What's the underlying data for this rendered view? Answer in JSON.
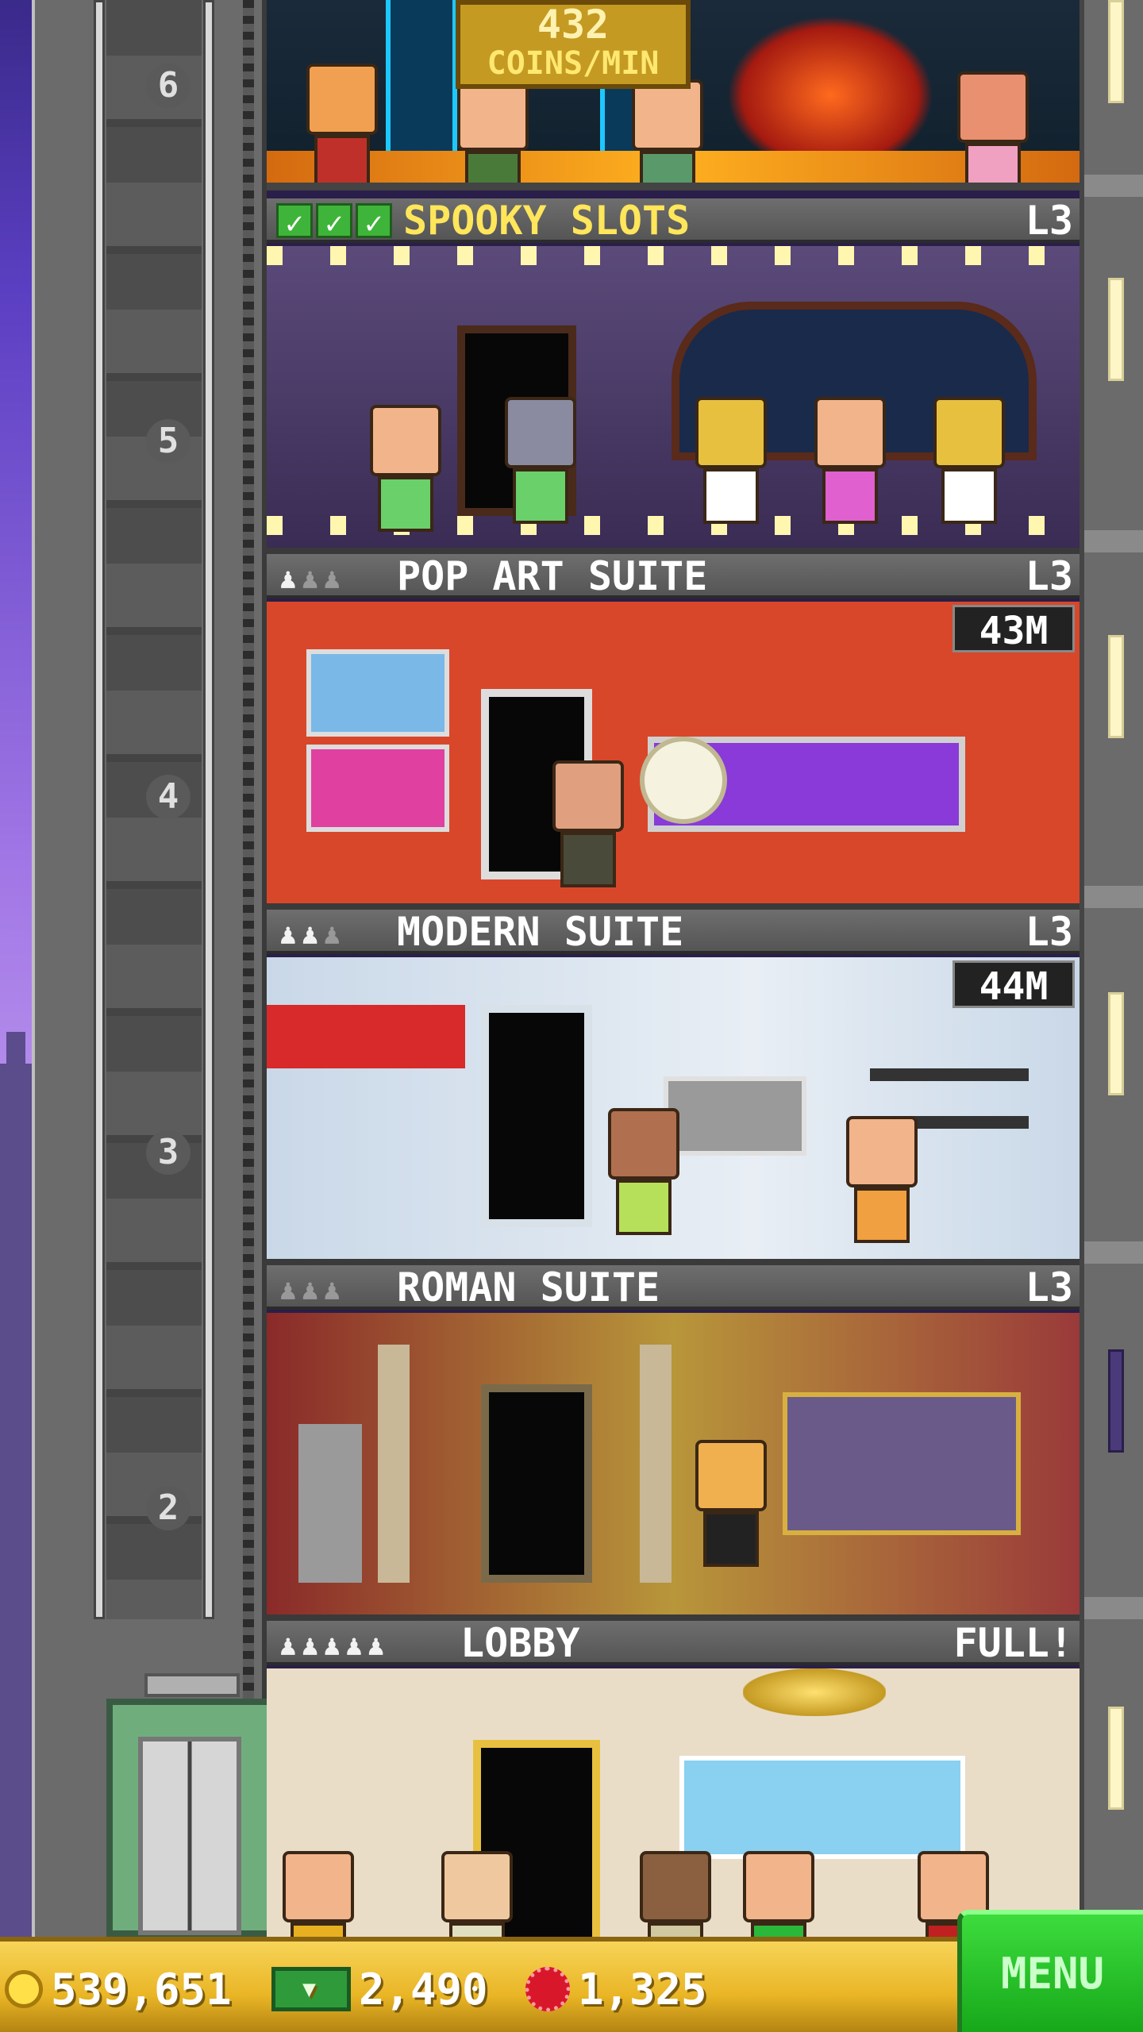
{
  "elevator": {
    "floor_numbers": [
      "6",
      "5",
      "4",
      "3",
      "2"
    ]
  },
  "top_floor": {
    "coins_rate_value": "432",
    "coins_rate_unit": "COINS/MIN"
  },
  "floors": [
    {
      "name": "SPOOKY SLOTS",
      "level": "L3",
      "checks": 3
    },
    {
      "name": "POP ART SUITE",
      "level": "L3",
      "stars_filled": 1,
      "stars_total": 3,
      "price": "43M"
    },
    {
      "name": "MODERN SUITE",
      "level": "L3",
      "stars_filled": 2,
      "stars_total": 3,
      "price": "44M"
    },
    {
      "name": "ROMAN SUITE",
      "level": "L3",
      "stars_filled": 0,
      "stars_total": 3
    },
    {
      "name": "LOBBY",
      "level": "FULL!",
      "stars_filled": 5,
      "stars_total": 5
    }
  ],
  "hud": {
    "coins": "539,651",
    "tower_bux": "2,490",
    "golden_tickets": "1,325",
    "menu_label": "MENU"
  },
  "colors": {
    "header_text_spooky": "#ffe65a",
    "menu_green": "#17a81a",
    "bar_gold": "#e9b525"
  }
}
